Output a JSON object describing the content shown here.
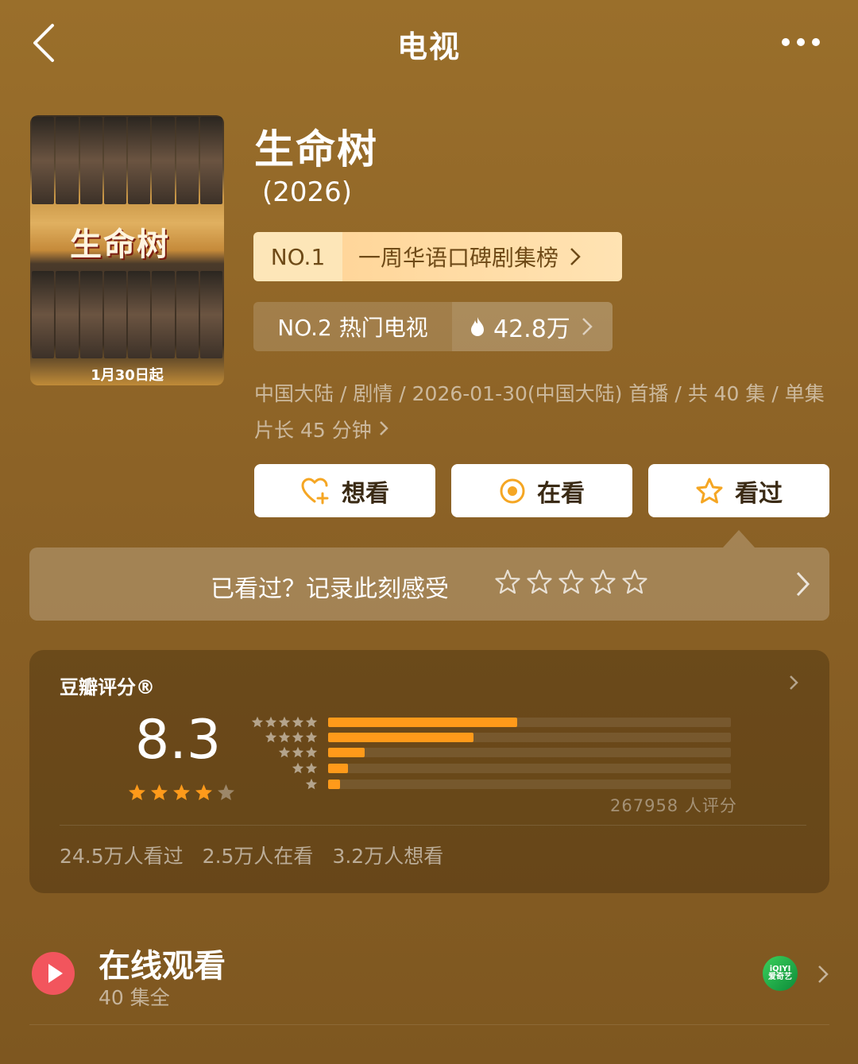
{
  "header": {
    "title": "电视",
    "back_icon": "chevron-left-icon",
    "more_icon": "more-dots-icon"
  },
  "poster": {
    "title_text": "生命树",
    "date_text": "1月30日起"
  },
  "show": {
    "name": "生命树",
    "year": "(2026)"
  },
  "rank1": {
    "no": "NO.1",
    "label": "一周华语口碑剧集榜"
  },
  "rank2": {
    "label": "NO.2 热门电视",
    "heat": "42.8万"
  },
  "meta": "中国大陆 / 剧情 / 2026-01-30(中国大陆) 首播 / 共 40 集 / 单集片长 45 分钟",
  "actions": {
    "want": "想看",
    "watching": "在看",
    "watched": "看过"
  },
  "record": {
    "text": "已看过？记录此刻感受"
  },
  "rating": {
    "title": "豆瓣评分®",
    "score": "8.3",
    "stars": 4,
    "distribution": [
      0.47,
      0.36,
      0.09,
      0.05,
      0.03
    ],
    "count": "267958 人评分",
    "watched": "24.5万人看过",
    "watching": "2.5万人在看",
    "want": "3.2万人想看"
  },
  "online": {
    "title": "在线观看",
    "sub": "40 集全",
    "platform_label": "iQIYI 爱奇艺"
  },
  "colors": {
    "accent": "#ff9a1a",
    "play": "#f2555d",
    "background": "#8c6226"
  }
}
